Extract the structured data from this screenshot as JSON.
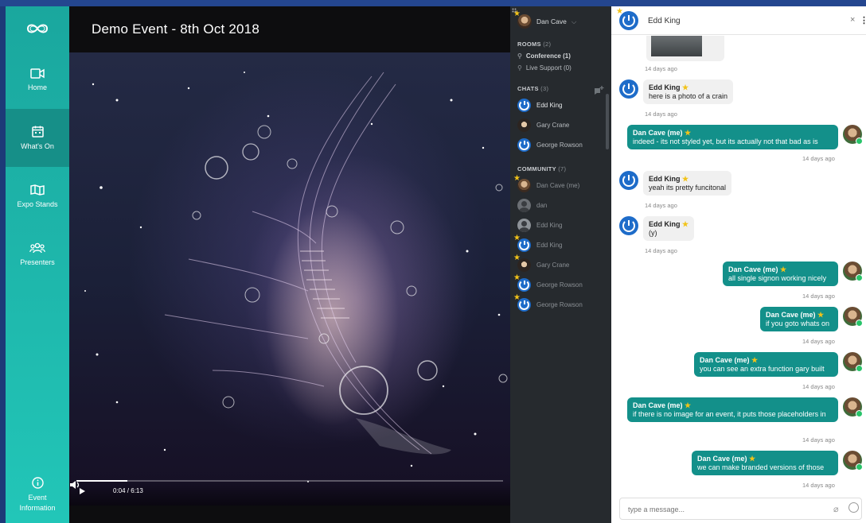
{
  "nav": {
    "items": [
      {
        "label": "Home",
        "icon": "video-camera-icon"
      },
      {
        "label": "What's On",
        "icon": "calendar-icon",
        "active": true
      },
      {
        "label": "Expo Stands",
        "icon": "map-icon"
      },
      {
        "label": "Presenters",
        "icon": "people-icon"
      }
    ],
    "footer": {
      "label_line1": "Event",
      "label_line2": "Information",
      "icon": "info-icon"
    }
  },
  "video": {
    "title": "Demo Event - 8th Oct 2018",
    "time": "0:04 / 6:13",
    "progress": 0.12
  },
  "sidebar": {
    "me_name": "Dan Cave",
    "rooms_label": "ROOMS",
    "rooms_count": "(2)",
    "rooms": [
      "Conference (1)",
      "Live Support (0)"
    ],
    "chats_label": "CHATS",
    "chats_count": "(3)",
    "chats": [
      "Edd King",
      "Gary Crane",
      "George Rowson"
    ],
    "community_label": "COMMUNITY",
    "community_count": "(7)",
    "community": [
      "Dan Cave (me)",
      "dan",
      "Edd King",
      "Edd King",
      "Gary Crane",
      "George Rowson",
      "George Rowson"
    ]
  },
  "chat": {
    "title": "Edd King",
    "close": "×",
    "more": "⋮",
    "messages": [
      {
        "ts": "14 days ago"
      },
      {
        "from": "Edd King",
        "text": "here is a photo of a crain",
        "ts": "14 days ago"
      },
      {
        "from": "Dan Cave (me)",
        "text": "indeed - its not styled yet, but its actually not that bad as is",
        "ts": "14 days ago"
      },
      {
        "from": "Edd King",
        "text": "yeah its pretty funcitonal",
        "ts": "14 days ago"
      },
      {
        "from": "Edd King",
        "text": "(y)",
        "ts": "14 days ago"
      },
      {
        "from": "Dan Cave (me)",
        "text": "all single signon working nicely",
        "ts": "14 days ago"
      },
      {
        "from": "Dan Cave (me)",
        "text": "if you goto whats on",
        "ts": "14 days ago"
      },
      {
        "from": "Dan Cave (me)",
        "text": "you can see an extra function gary built",
        "ts": "14 days ago"
      },
      {
        "from": "Dan Cave (me)",
        "text": "if there is no image for an event, it puts those placeholders in",
        "ts": "14 days ago"
      },
      {
        "from": "Dan Cave (me)",
        "text": "we can make branded versions of those",
        "ts": "14 days ago"
      }
    ],
    "composer_placeholder": "type a message..."
  },
  "colors": {
    "teal": "#22c6b8",
    "bubble_out": "#13908a",
    "star": "#f2c318",
    "blue_avatar": "#1e6cc9"
  }
}
